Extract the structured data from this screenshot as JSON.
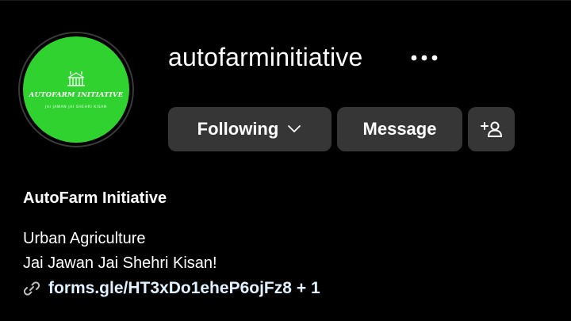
{
  "profile": {
    "username": "autofarminitiative",
    "display_name": "AutoFarm Initiative",
    "avatar": {
      "logo_title": "AUTOFARM INITIATIVE",
      "logo_subtitle": "JAI JAWAN JAI SHEHRI KISAN",
      "background_color": "#2fd22f",
      "icon": "farm-building-icon"
    },
    "bio_lines": [
      "Urban Agriculture",
      "Jai Jawan Jai Shehri Kisan!"
    ],
    "link": {
      "icon": "link-icon",
      "text": "forms.gle/HT3xDo1eheP6ojFz8",
      "extra": "+ 1"
    }
  },
  "actions": {
    "more_icon": "more-horizontal-icon",
    "following_label": "Following",
    "following_icon": "chevron-down-icon",
    "message_label": "Message",
    "add_user_icon": "add-user-icon"
  },
  "colors": {
    "background": "#000000",
    "button_bg": "#363636",
    "text": "#ffffff",
    "link_text": "#e0f1ff"
  }
}
